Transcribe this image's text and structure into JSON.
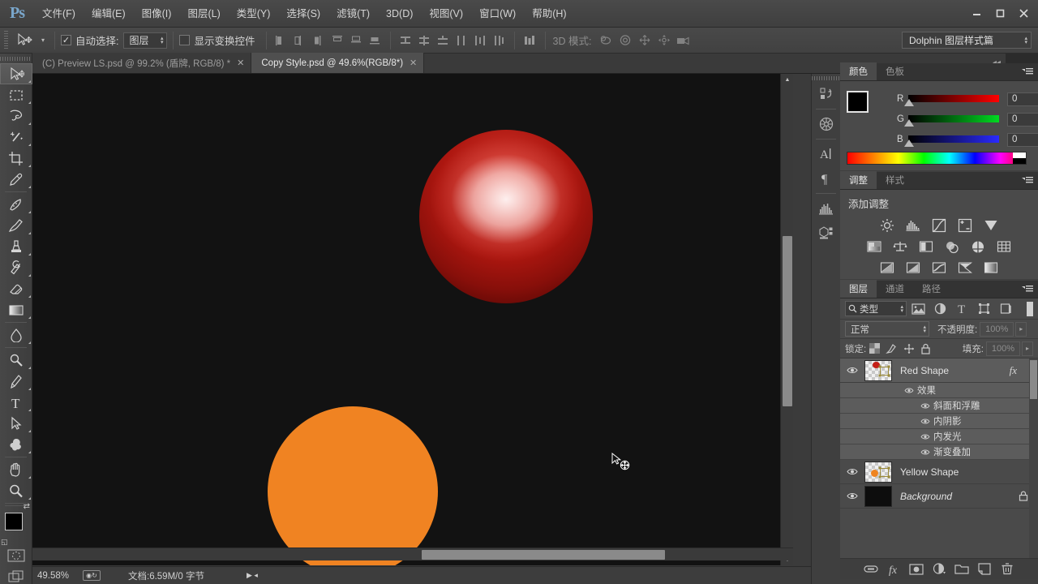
{
  "app": {
    "logo": "Ps",
    "window_controls": {
      "minimize": "–",
      "maximize": "□",
      "close": "✕"
    }
  },
  "menubar": {
    "items": [
      {
        "label": "文件(F)",
        "name": "menu-file"
      },
      {
        "label": "编辑(E)",
        "name": "menu-edit"
      },
      {
        "label": "图像(I)",
        "name": "menu-image"
      },
      {
        "label": "图层(L)",
        "name": "menu-layer"
      },
      {
        "label": "类型(Y)",
        "name": "menu-type"
      },
      {
        "label": "选择(S)",
        "name": "menu-select"
      },
      {
        "label": "滤镜(T)",
        "name": "menu-filter"
      },
      {
        "label": "3D(D)",
        "name": "menu-3d"
      },
      {
        "label": "视图(V)",
        "name": "menu-view"
      },
      {
        "label": "窗口(W)",
        "name": "menu-window"
      },
      {
        "label": "帮助(H)",
        "name": "menu-help"
      }
    ]
  },
  "options_bar": {
    "tool_icon": "move-tool-icon",
    "auto_select_checked": "✓",
    "auto_select_label": "自动选择:",
    "auto_select_value": "图层",
    "show_transform_label": "显示变换控件",
    "show_transform_checked": false,
    "three_d_mode_label": "3D 模式:",
    "workspace_value": "Dolphin 图层样式篇"
  },
  "document_tabs": [
    {
      "label": "(C) Preview LS.psd @ 99.2% (盾牌, RGB/8) *",
      "active": false,
      "close": "✕"
    },
    {
      "label": "Copy Style.psd @ 49.6%(RGB/8*)",
      "active": true,
      "close": "✕"
    }
  ],
  "toolbar": {
    "tools": [
      {
        "name": "move-tool",
        "selected": true
      },
      {
        "name": "rectangular-marquee-tool",
        "selected": false
      },
      {
        "name": "lasso-tool",
        "selected": false
      },
      {
        "name": "magic-wand-tool",
        "selected": false
      },
      {
        "name": "crop-tool",
        "selected": false
      },
      {
        "name": "eyedropper-tool",
        "selected": false
      },
      {
        "name": "healing-brush-tool",
        "selected": false
      },
      {
        "name": "brush-tool",
        "selected": false
      },
      {
        "name": "clone-stamp-tool",
        "selected": false
      },
      {
        "name": "history-brush-tool",
        "selected": false
      },
      {
        "name": "eraser-tool",
        "selected": false
      },
      {
        "name": "gradient-tool",
        "selected": false
      },
      {
        "name": "blur-tool",
        "selected": false
      },
      {
        "name": "dodge-tool",
        "selected": false
      },
      {
        "name": "pen-tool",
        "selected": false
      },
      {
        "name": "type-tool",
        "selected": false
      },
      {
        "name": "path-selection-tool",
        "selected": false
      },
      {
        "name": "custom-shape-tool",
        "selected": false
      },
      {
        "name": "hand-tool",
        "selected": false
      },
      {
        "name": "zoom-tool",
        "selected": false
      }
    ],
    "foreground_color": "#000000",
    "background_color": "#ffffff"
  },
  "canvas": {
    "background_color": "#121212",
    "shapes": [
      {
        "name": "red-shape",
        "type": "circle",
        "color": "#c02018",
        "styled": true
      },
      {
        "name": "yellow-shape",
        "type": "circle",
        "color": "#f08322",
        "styled": false
      }
    ],
    "cursor": "move-cursor"
  },
  "status_bar": {
    "zoom": "49.58%",
    "doc_info": "文档:6.59M/0 字节"
  },
  "icon_dock": {
    "items": [
      {
        "name": "history-panel-icon"
      },
      {
        "name": "mini-bridge-panel-icon"
      },
      {
        "name": "character-panel-icon"
      },
      {
        "name": "paragraph-panel-icon"
      },
      {
        "name": "histogram-panel-icon"
      },
      {
        "name": "3d-panel-icon"
      }
    ]
  },
  "color_panel": {
    "tabs": [
      {
        "label": "颜色",
        "active": true
      },
      {
        "label": "色板",
        "active": false
      }
    ],
    "channels": [
      {
        "label": "R",
        "value": "0"
      },
      {
        "label": "G",
        "value": "0"
      },
      {
        "label": "B",
        "value": "0"
      }
    ],
    "foreground": "#000000",
    "background": "#f2f2f2"
  },
  "adjustments_panel": {
    "tabs": [
      {
        "label": "调整",
        "active": true
      },
      {
        "label": "样式",
        "active": false
      }
    ],
    "title": "添加调整",
    "rows": [
      [
        "brightness-contrast-icon",
        "levels-icon",
        "curves-icon",
        "exposure-icon",
        "vibrance-icon"
      ],
      [
        "hue-saturation-icon",
        "color-balance-icon",
        "black-white-icon",
        "photo-filter-icon",
        "channel-mixer-icon",
        "color-lookup-icon"
      ],
      [
        "invert-icon",
        "posterize-icon",
        "threshold-icon",
        "selective-color-icon",
        "gradient-map-icon"
      ]
    ]
  },
  "layers_panel": {
    "tabs": [
      {
        "label": "图层",
        "active": true
      },
      {
        "label": "通道",
        "active": false
      },
      {
        "label": "路径",
        "active": false
      }
    ],
    "filter_label": "类型",
    "filter_icons": [
      "pixel-filter-icon",
      "adjustment-filter-icon",
      "type-filter-icon",
      "shape-filter-icon",
      "smart-object-filter-icon"
    ],
    "blend_mode": "正常",
    "opacity_label": "不透明度:",
    "opacity_value": "100%",
    "lock_label": "锁定:",
    "lock_icons": [
      "lock-transparency-icon",
      "lock-image-icon",
      "lock-position-icon",
      "lock-all-icon"
    ],
    "fill_label": "填充:",
    "fill_value": "100%",
    "layers": [
      {
        "name": "Red Shape",
        "visible": true,
        "selected": true,
        "has_fx": "fx",
        "locked": false,
        "italic": false,
        "thumb": "red-shape-thumb",
        "effects_group_label": "效果",
        "effects": [
          "斜面和浮雕",
          "内阴影",
          "内发光",
          "渐变叠加"
        ]
      },
      {
        "name": "Yellow Shape",
        "visible": true,
        "selected": false,
        "has_fx": "",
        "locked": false,
        "italic": false,
        "thumb": "yellow-shape-thumb",
        "effects": []
      },
      {
        "name": "Background",
        "visible": true,
        "selected": false,
        "has_fx": "",
        "locked": true,
        "italic": true,
        "thumb": "background-thumb",
        "effects": []
      }
    ],
    "footer_icons": [
      "link-layers-icon",
      "add-layer-style-icon",
      "add-layer-mask-icon",
      "new-adjustment-layer-icon",
      "new-group-icon",
      "new-layer-icon",
      "delete-layer-icon"
    ]
  }
}
